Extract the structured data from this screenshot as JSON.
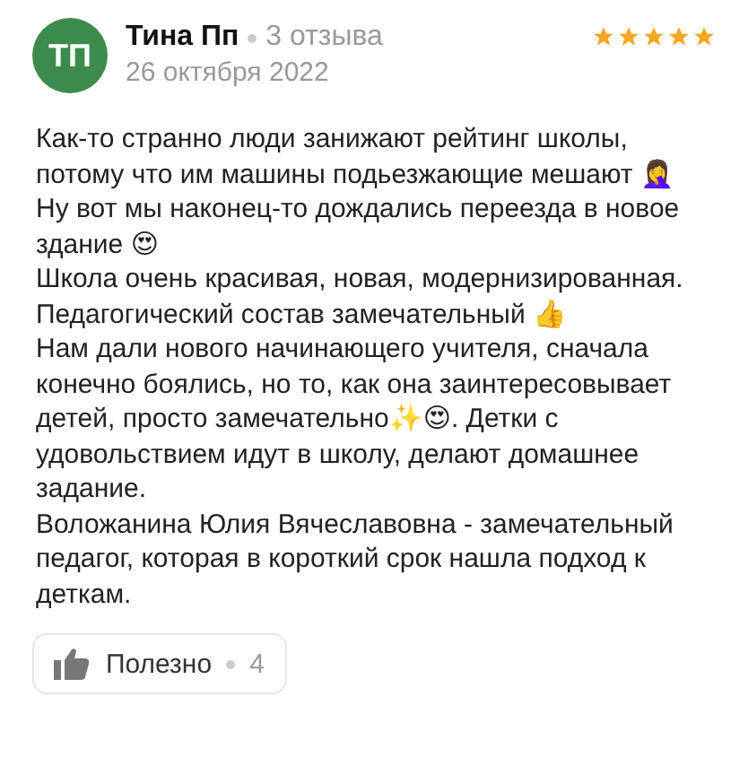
{
  "author": {
    "initials": "ТП",
    "name": "Тина Пп",
    "reviews": "3 отзыва",
    "date": "26 октября 2022"
  },
  "rating": {
    "stars": 5
  },
  "paragraphs": [
    "Как-то странно люди занижают рейтинг школы, потому что им машины подьезжающие мешают 🤦‍♀️",
    "Ну вот мы наконец-то дождались переезда в новое здание 😍",
    "Школа очень красивая, новая, модернизированная. Педагогический состав замечательный 👍",
    "Нам дали нового начинающего учителя, сначала конечно боялись, но то, как она заинтересовывает детей, просто замечательно✨😍. Детки с удовольствием идут в школу, делают домашнее задание.",
    "Воложанина Юлия Вячеславовна - замечательный педагог, которая в короткий срок нашла подход к деткам."
  ],
  "helpful": {
    "label": "Полезно",
    "count": "4"
  }
}
